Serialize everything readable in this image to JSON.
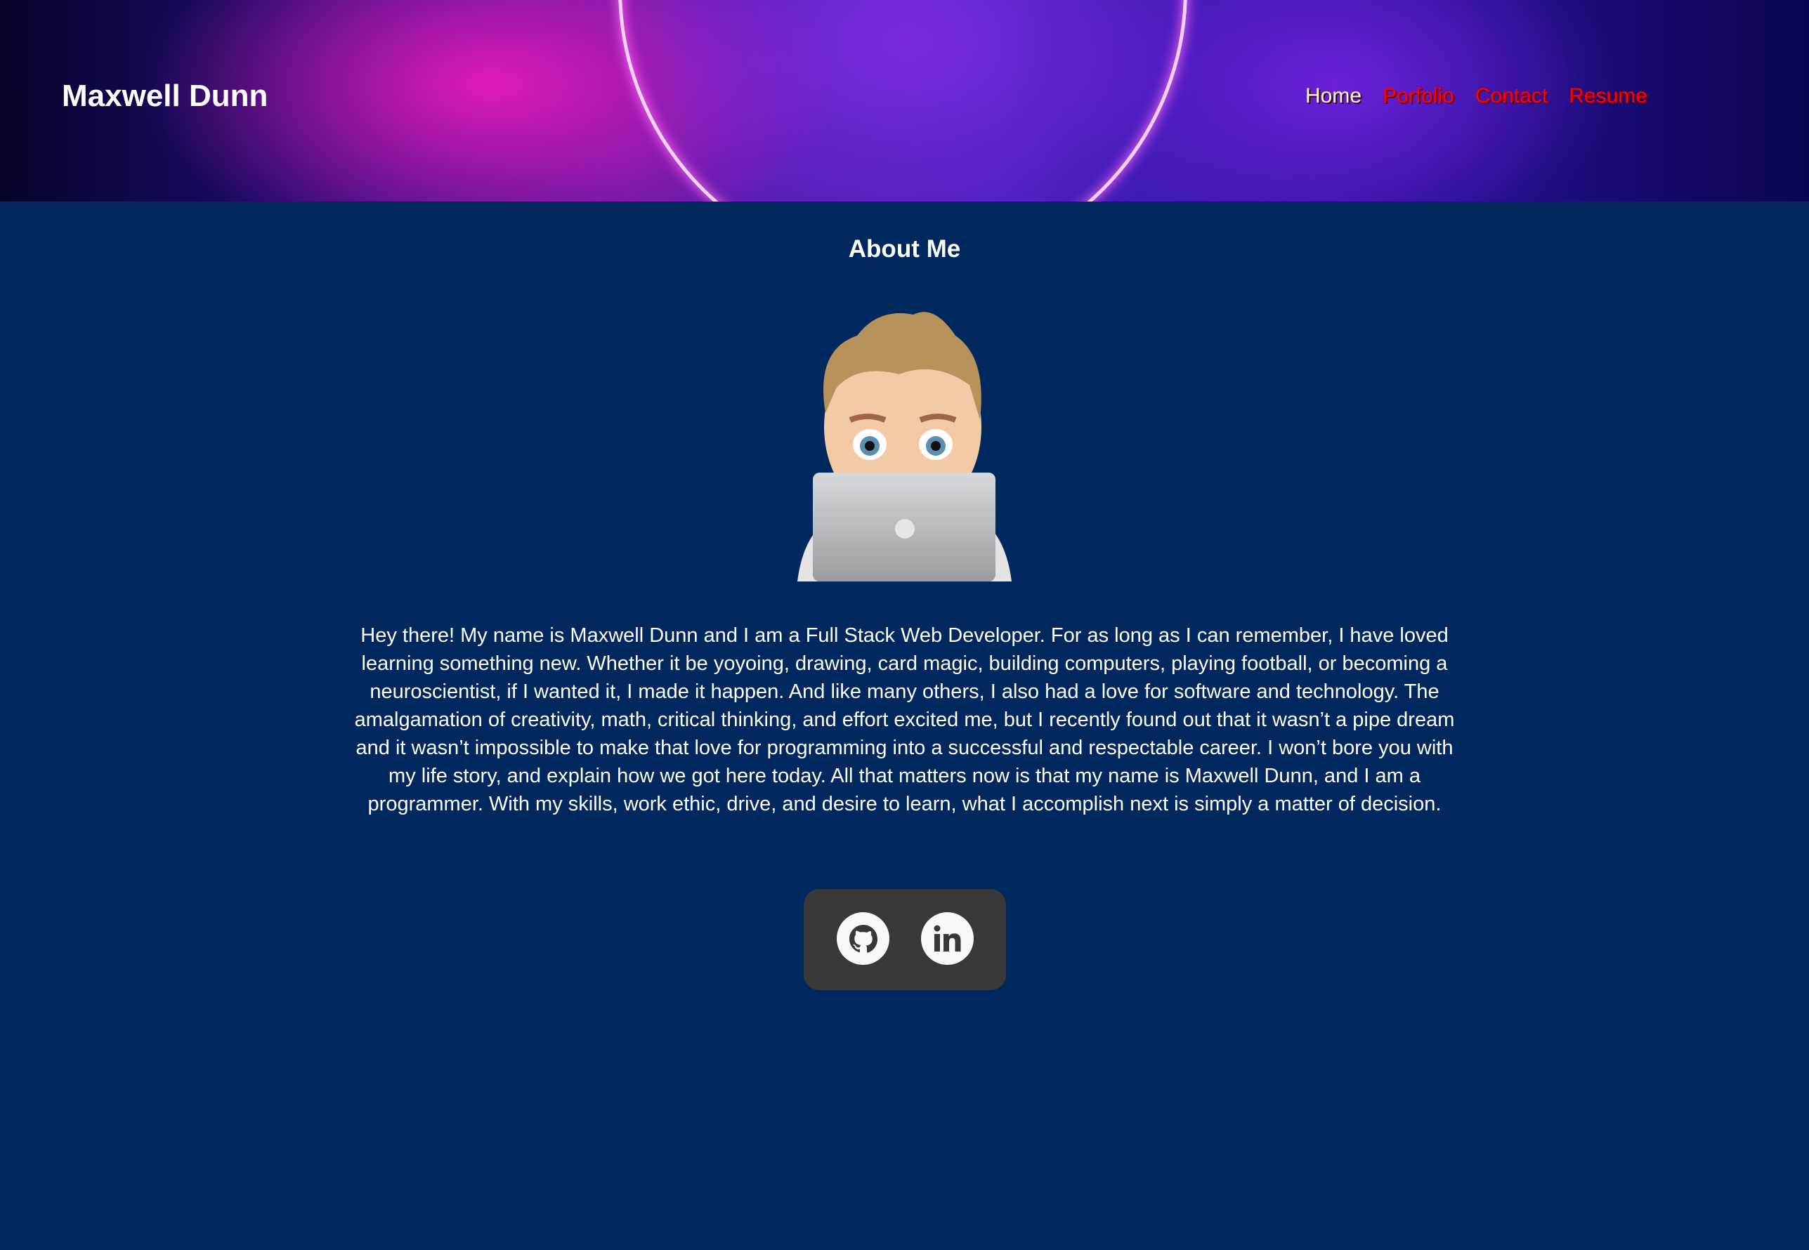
{
  "header": {
    "title": "Maxwell Dunn",
    "nav": [
      {
        "label": "Home",
        "active": true
      },
      {
        "label": "Porfolio"
      },
      {
        "label": "Contact"
      },
      {
        "label": "Resume"
      }
    ],
    "nav_color": "#ff0000"
  },
  "main": {
    "heading": "About Me",
    "avatar": "memoji-with-laptop",
    "bio": "Hey there! My name is Maxwell Dunn and I am a Full Stack Web Developer. For as long as I can remember, I have loved learning something new. Whether it be yoyoing, drawing, card magic, building computers, playing football, or becoming a neuroscientist, if I wanted it, I made it happen. And like many others, I also had a love for software and technology. The amalgamation of creativity, math, critical thinking, and effort excited me, but I recently found out that it wasn’t a pipe dream and it wasn’t impossible to make that love for programming into a successful and respectable career. I won’t bore you with my life story, and explain how we got here today. All that matters now is that my name is Maxwell Dunn, and I am a programmer. With my skills, work ethic, drive, and desire to learn, what I accomplish next is simply a matter of decision."
  },
  "social": [
    {
      "icon": "github-icon"
    },
    {
      "icon": "linkedin-icon"
    }
  ],
  "colors": {
    "background": "#00285e",
    "social_box": "#383838"
  }
}
